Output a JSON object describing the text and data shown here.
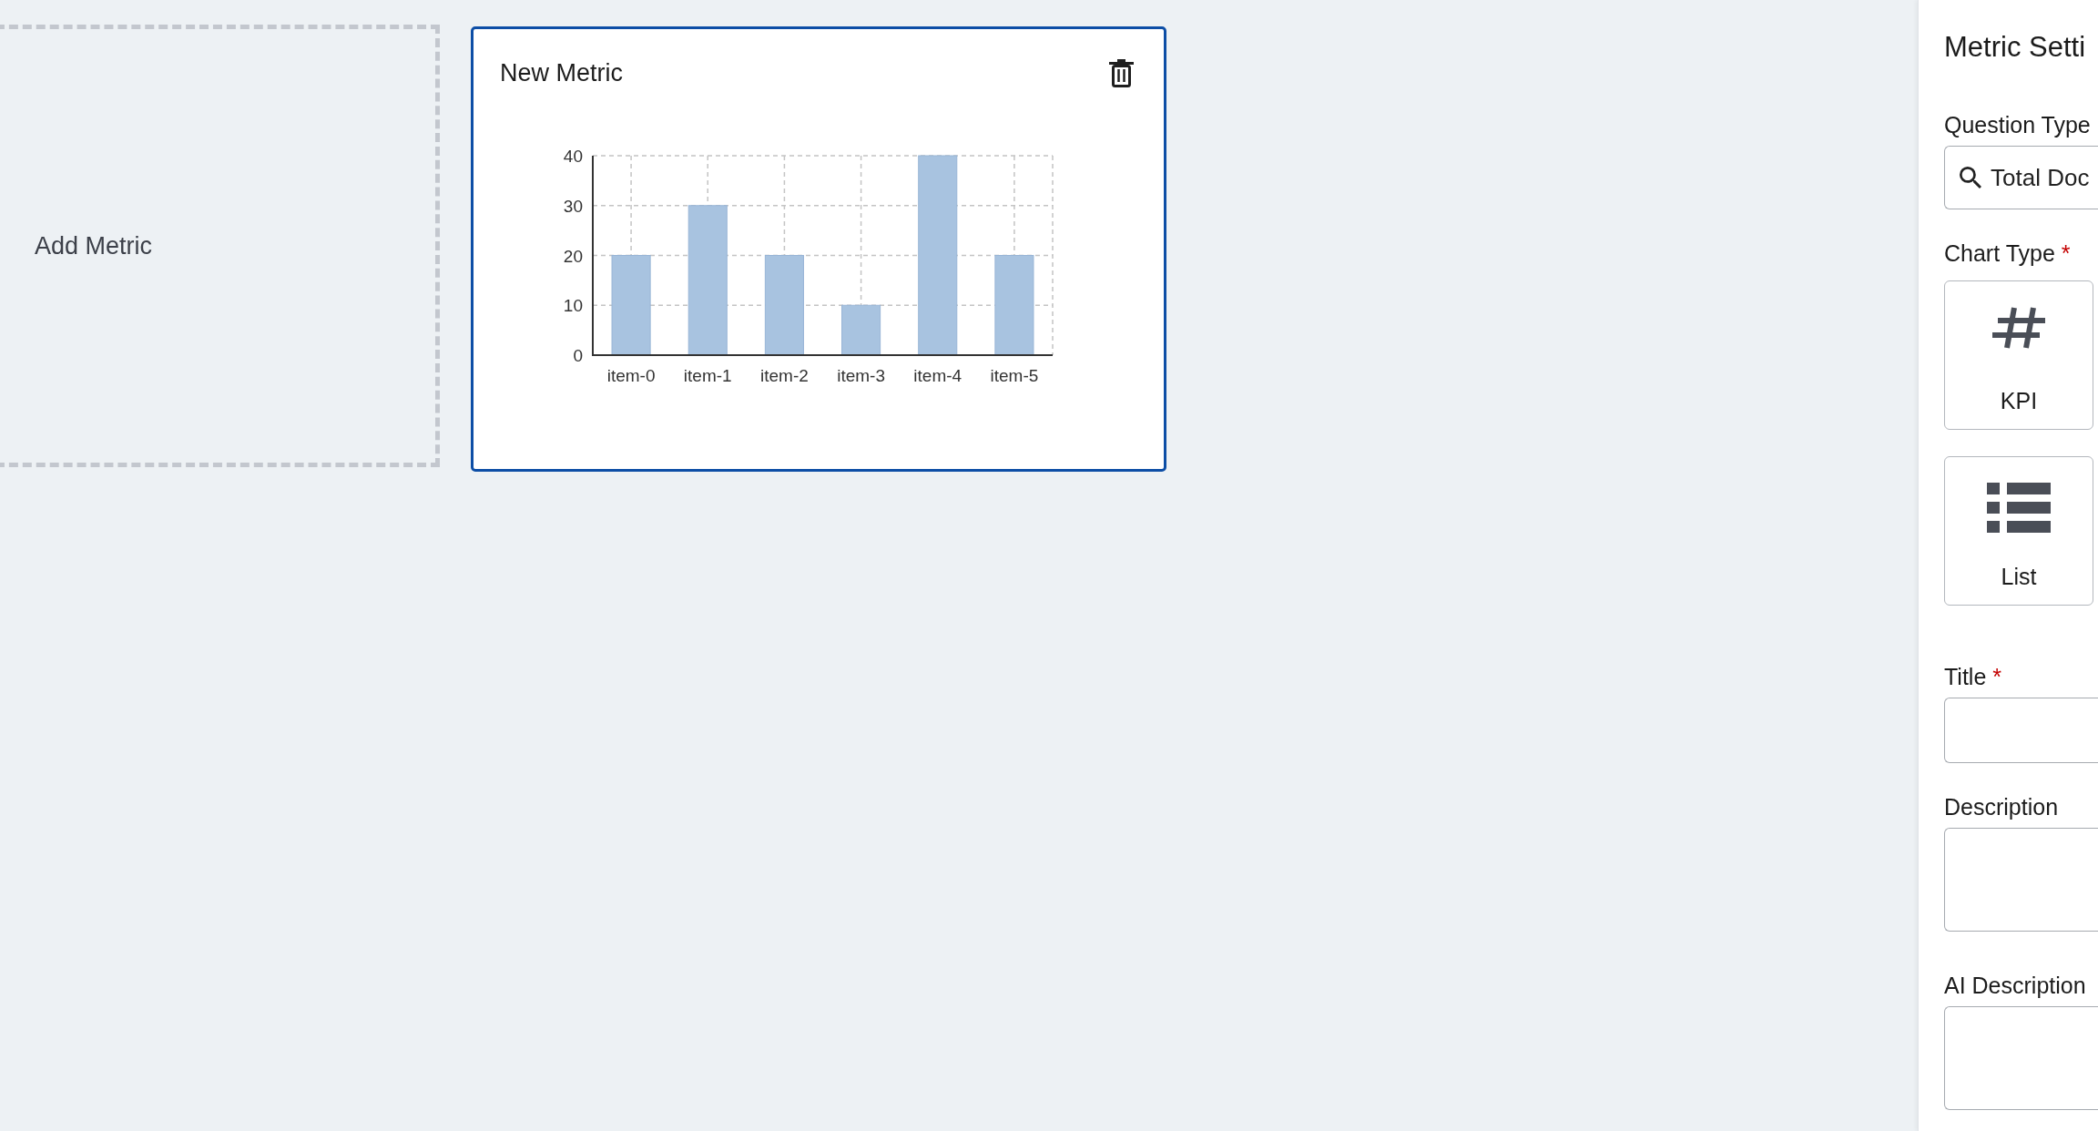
{
  "canvas": {
    "add_tile": {
      "label": "Add Metric"
    },
    "metric_cards": [
      {
        "title": "New Metric",
        "selected": true,
        "chart_data": {
          "type": "bar",
          "categories": [
            "item-0",
            "item-1",
            "item-2",
            "item-3",
            "item-4",
            "item-5"
          ],
          "values": [
            20,
            30,
            20,
            10,
            40,
            20
          ],
          "ylim": [
            0,
            40
          ],
          "yticks": [
            0,
            10,
            20,
            30,
            40
          ],
          "grid": true
        }
      }
    ]
  },
  "settings_panel": {
    "title": "Metric Setti",
    "question_type": {
      "label": "Question Type",
      "value": "Total Doc"
    },
    "chart_type": {
      "label": "Chart Type",
      "required_mark": "*",
      "options": [
        {
          "kind": "kpi",
          "label": "KPI",
          "selected": false
        },
        {
          "kind": "list",
          "label": "List",
          "selected": false
        }
      ]
    },
    "fields": [
      {
        "kind": "input",
        "label": "Title",
        "required_mark": "*"
      },
      {
        "kind": "textarea",
        "label": "Description"
      },
      {
        "kind": "textarea",
        "label": "AI Description"
      }
    ]
  }
}
